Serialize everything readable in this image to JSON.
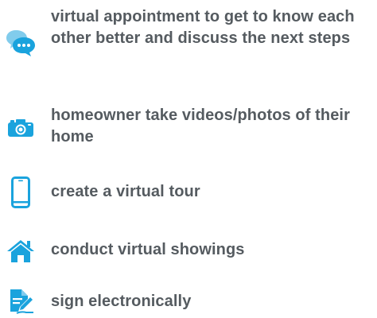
{
  "steps": [
    {
      "icon": "chat-bubbles-icon",
      "text": "virtual appointment to get to know each other better and discuss the next steps"
    },
    {
      "icon": "camera-icon",
      "text": "homeowner take videos/photos of their home"
    },
    {
      "icon": "smartphone-icon",
      "text": "create a virtual tour"
    },
    {
      "icon": "house-icon",
      "text": "conduct virtual showings"
    },
    {
      "icon": "document-sign-icon",
      "text": "sign electronically"
    }
  ],
  "colors": {
    "accent": "#1aa3dd",
    "text": "#555b60"
  }
}
